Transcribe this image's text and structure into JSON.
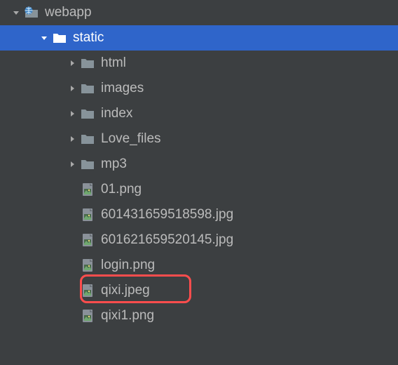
{
  "tree": {
    "items": [
      {
        "depth": 0,
        "arrow": "down",
        "iconType": "folder-web",
        "label": "webapp",
        "selected": false
      },
      {
        "depth": 1,
        "arrow": "down",
        "iconType": "folder",
        "label": "static",
        "selected": true
      },
      {
        "depth": 2,
        "arrow": "right",
        "iconType": "folder",
        "label": "html",
        "selected": false
      },
      {
        "depth": 2,
        "arrow": "right",
        "iconType": "folder",
        "label": "images",
        "selected": false
      },
      {
        "depth": 2,
        "arrow": "right",
        "iconType": "folder",
        "label": "index",
        "selected": false
      },
      {
        "depth": 2,
        "arrow": "right",
        "iconType": "folder",
        "label": "Love_files",
        "selected": false
      },
      {
        "depth": 2,
        "arrow": "right",
        "iconType": "folder",
        "label": "mp3",
        "selected": false
      },
      {
        "depth": 2,
        "arrow": "none",
        "iconType": "image",
        "label": "01.png",
        "selected": false
      },
      {
        "depth": 2,
        "arrow": "none",
        "iconType": "image",
        "label": "601431659518598.jpg",
        "selected": false
      },
      {
        "depth": 2,
        "arrow": "none",
        "iconType": "image",
        "label": "601621659520145.jpg",
        "selected": false
      },
      {
        "depth": 2,
        "arrow": "none",
        "iconType": "image",
        "label": "login.png",
        "selected": false,
        "highlighted": true
      },
      {
        "depth": 2,
        "arrow": "none",
        "iconType": "image",
        "label": "qixi.jpeg",
        "selected": false
      },
      {
        "depth": 2,
        "arrow": "none",
        "iconType": "image",
        "label": "qixi1.png",
        "selected": false
      }
    ]
  },
  "style": {
    "indentBase": 14,
    "indentStep": 40
  }
}
